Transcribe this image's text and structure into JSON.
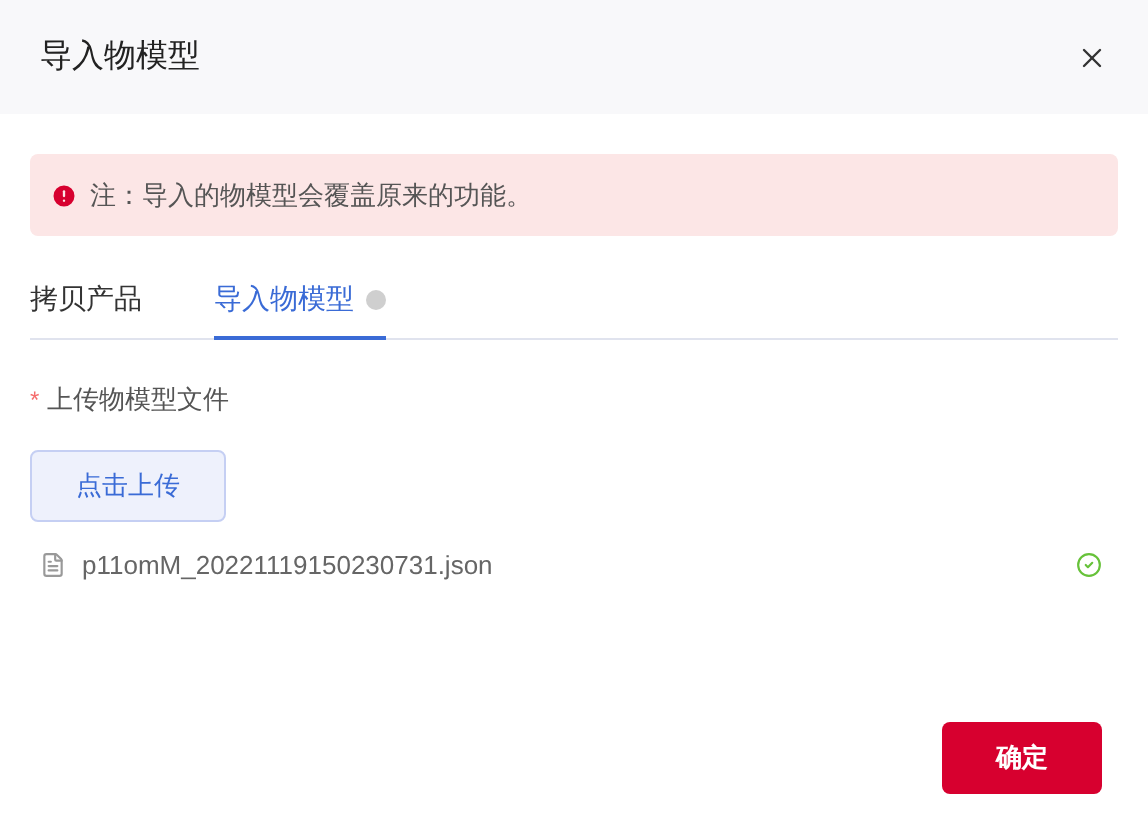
{
  "dialog": {
    "title": "导入物模型"
  },
  "alert": {
    "kind": "error",
    "text": "注：导入的物模型会覆盖原来的功能。"
  },
  "tabs": [
    {
      "label": "拷贝产品",
      "selected": false,
      "info": false
    },
    {
      "label": "导入物模型",
      "selected": true,
      "info": true
    }
  ],
  "form": {
    "required_mark": "*",
    "label": "上传物模型文件",
    "upload_button": "点击上传",
    "files": [
      {
        "name": "p11omM_20221119150230731.json",
        "uploaded": true
      }
    ]
  },
  "footer": {
    "confirm_button": "确定"
  }
}
